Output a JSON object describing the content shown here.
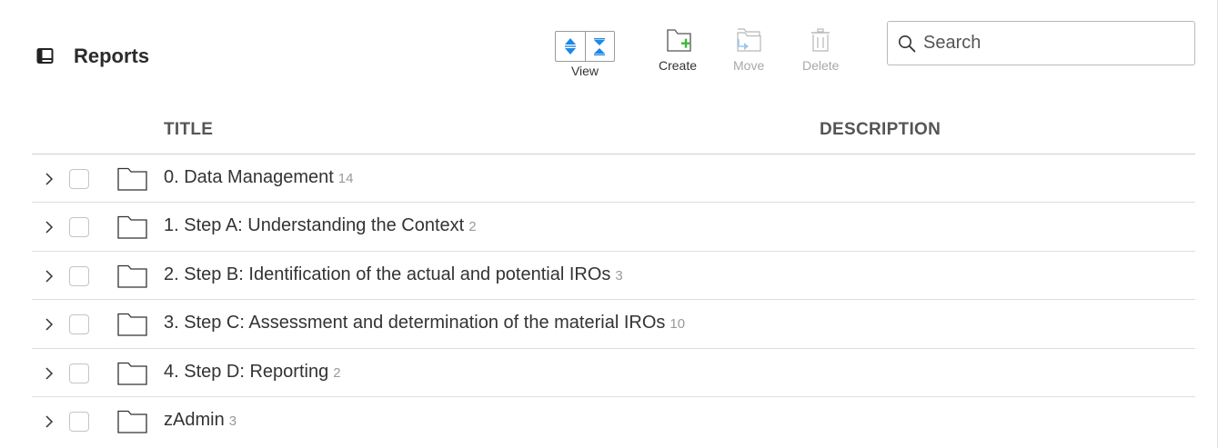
{
  "header": {
    "title": "Reports",
    "icon": "book-icon"
  },
  "toolbar": {
    "view_label": "View",
    "create_label": "Create",
    "move_label": "Move",
    "delete_label": "Delete"
  },
  "search": {
    "placeholder": "Search",
    "value": ""
  },
  "columns": {
    "title": "TITLE",
    "description": "DESCRIPTION"
  },
  "rows": [
    {
      "name": "0. Data Management",
      "count": "14"
    },
    {
      "name": "1. Step A: Understanding the Context",
      "count": "2"
    },
    {
      "name": "2. Step B: Identification of the actual and potential IROs",
      "count": "3"
    },
    {
      "name": "3. Step C: Assessment and determination of the material IROs",
      "count": "10"
    },
    {
      "name": "4. Step D: Reporting",
      "count": "2"
    },
    {
      "name": "zAdmin",
      "count": "3"
    }
  ],
  "colors": {
    "view_arrows": "#1e88e5",
    "create_plus": "#3cb83c",
    "move_arrow": "#9cc8ef",
    "disabled_text": "#a8a8a8"
  }
}
